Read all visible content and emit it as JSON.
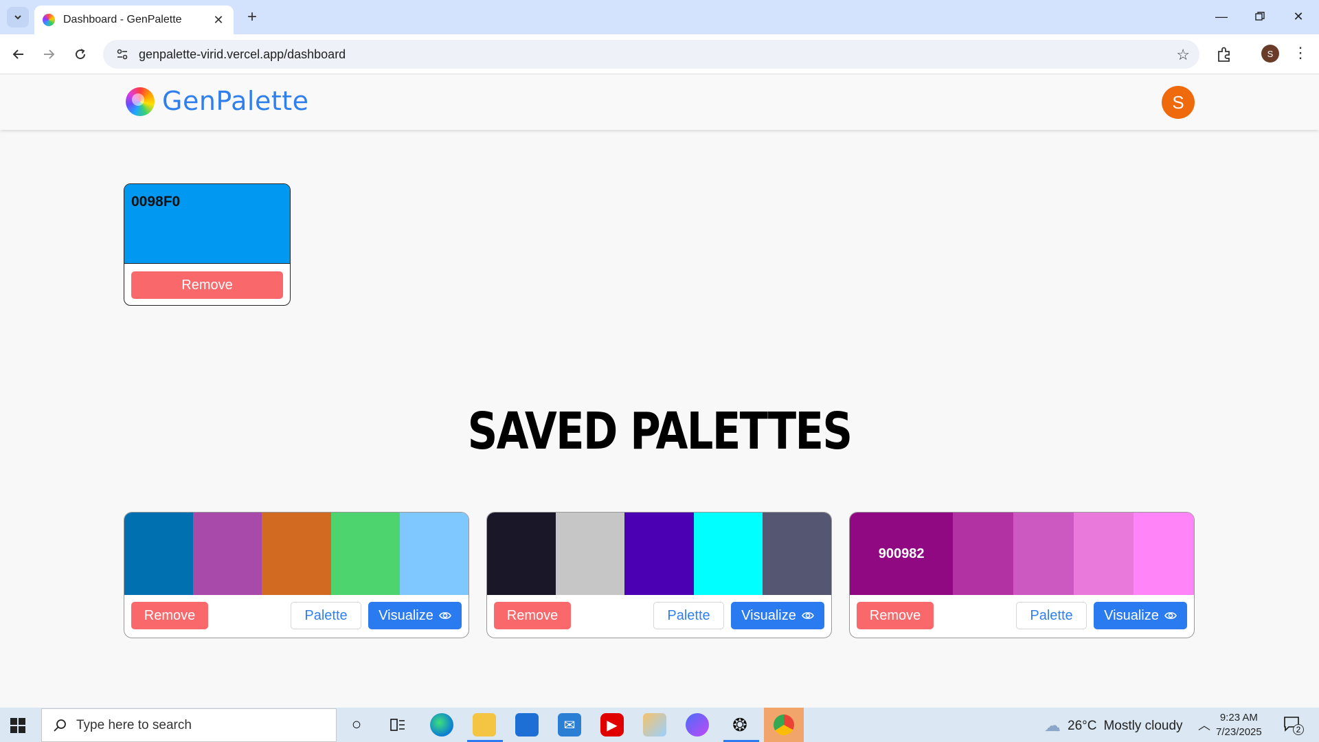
{
  "browser": {
    "tab_title": "Dashboard - GenPalette",
    "url": "genpalette-virid.vercel.app/dashboard",
    "profile_initial": "S"
  },
  "app": {
    "logo_text": "GenPalette",
    "avatar_initial": "S",
    "brand_color": "#2f80ed"
  },
  "saved_color": {
    "hex": "0098F0",
    "color": "#0098F0",
    "remove_label": "Remove"
  },
  "saved_palettes_title": "SAVED PALETTES",
  "palettes": [
    {
      "colors": [
        "#0070B0",
        "#A84AAA",
        "#D26A22",
        "#4DD46E",
        "#7EC8FF"
      ],
      "highlight_label": "",
      "remove_label": "Remove",
      "palette_label": "Palette",
      "visualize_label": "Visualize"
    },
    {
      "colors": [
        "#1A1828",
        "#C6C6C6",
        "#4B00B4",
        "#00FFFF",
        "#555671"
      ],
      "highlight_label": "",
      "remove_label": "Remove",
      "palette_label": "Palette",
      "visualize_label": "Visualize"
    },
    {
      "colors": [
        "#900982",
        "#B232A4",
        "#CC58C2",
        "#E979DA",
        "#FF84F7"
      ],
      "highlight_label": "900982",
      "remove_label": "Remove",
      "palette_label": "Palette",
      "visualize_label": "Visualize"
    }
  ],
  "taskbar": {
    "search_placeholder": "Type here to search",
    "weather_temp": "26°C",
    "weather_desc": "Mostly cloudy",
    "time": "9:23 AM",
    "date": "7/23/2025",
    "notification_count": "2"
  }
}
